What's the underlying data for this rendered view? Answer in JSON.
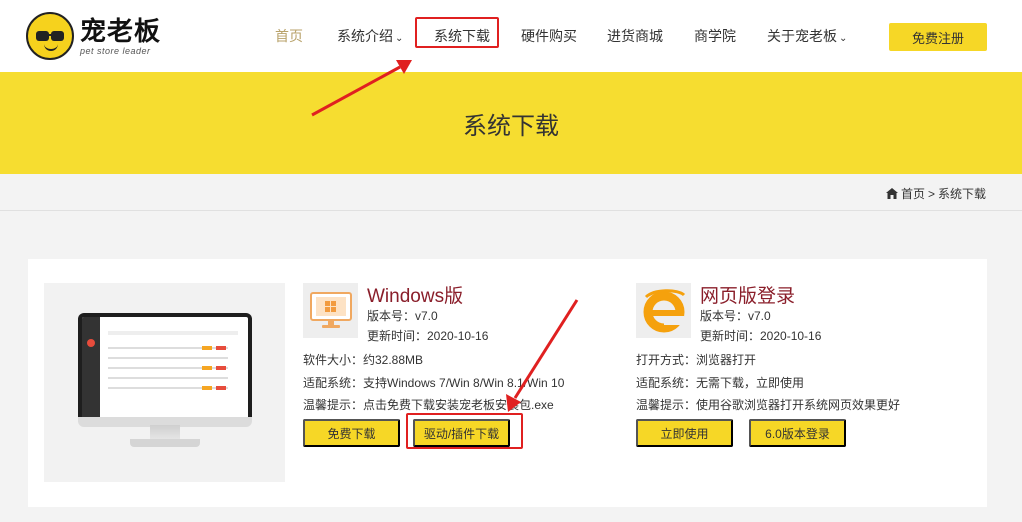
{
  "brand": {
    "title": "宠老板",
    "subtitle": "pet store leader"
  },
  "nav": {
    "items": [
      {
        "label": "首页",
        "active": true,
        "dropdown": false
      },
      {
        "label": "系统介绍",
        "active": false,
        "dropdown": true
      },
      {
        "label": "系统下载",
        "active": false,
        "dropdown": false
      },
      {
        "label": "硬件购买",
        "active": false,
        "dropdown": false
      },
      {
        "label": "进货商城",
        "active": false,
        "dropdown": false
      },
      {
        "label": "商学院",
        "active": false,
        "dropdown": false
      },
      {
        "label": "关于宠老板",
        "active": false,
        "dropdown": true
      }
    ],
    "register": "免费注册"
  },
  "banner": {
    "title": "系统下载"
  },
  "breadcrumb": {
    "home": "首页",
    "separator": ">",
    "current": "系统下载"
  },
  "windows": {
    "title": "Windows版",
    "version": "版本号：v7.0",
    "updated": "更新时间：2020-10-16",
    "size": "软件大小：约32.88MB",
    "compat": "适配系统：支持Windows 7/Win 8/Win 8.1/Win 10",
    "tip": "温馨提示：点击免费下载安装宠老板安装包.exe",
    "btn_download": "免费下载",
    "btn_driver": "驱动/插件下载"
  },
  "web": {
    "title": "网页版登录",
    "version": "版本号：v7.0",
    "updated": "更新时间：2020-10-16",
    "open": "打开方式：浏览器打开",
    "compat": "适配系统：无需下载，立即使用",
    "tip": "温馨提示：使用谷歌浏览器打开系统网页效果更好",
    "btn_use": "立即使用",
    "btn_v6": "6.0版本登录"
  },
  "colors": {
    "accent_yellow": "#f6dd30",
    "button_yellow": "#f6d726",
    "title_red": "#8a1e2a",
    "annotation_red": "#e02020",
    "nav_active": "#b8a26a"
  },
  "icons": {
    "windows": "windows-monitor-icon",
    "web": "ie-browser-icon",
    "home": "home-icon"
  }
}
